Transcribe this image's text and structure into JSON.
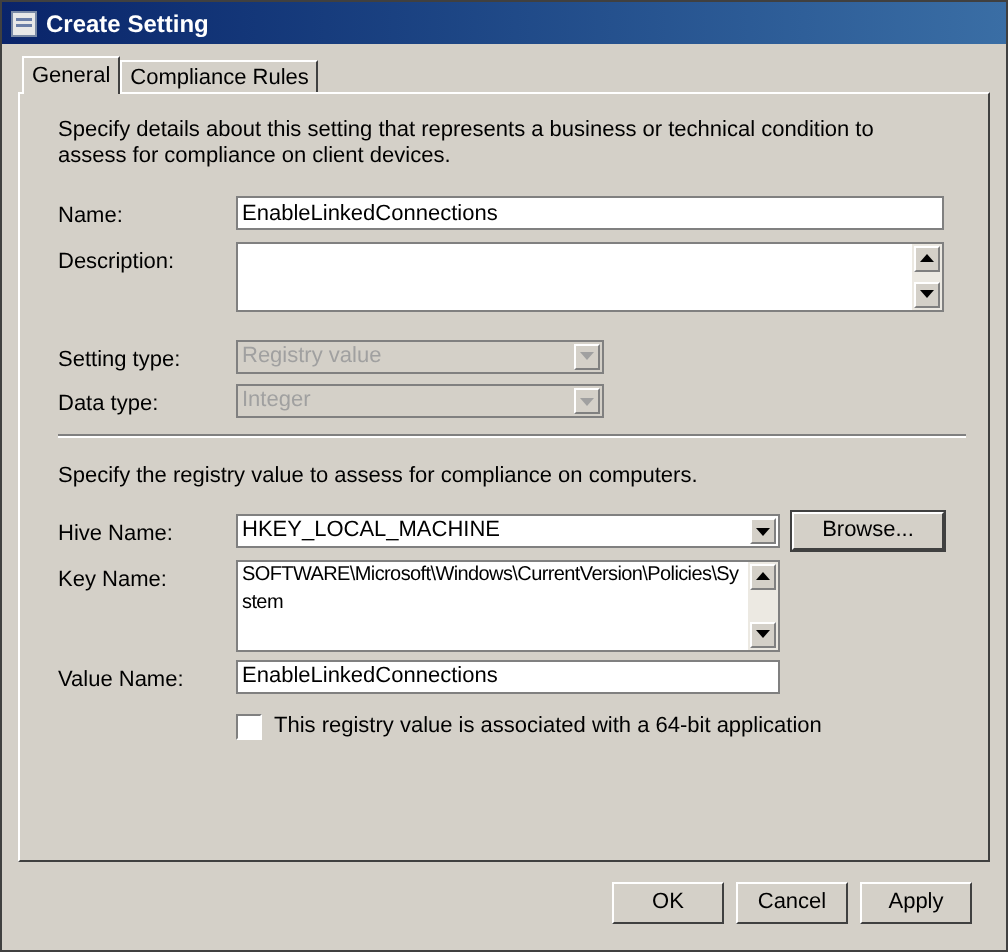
{
  "window": {
    "title": "Create Setting"
  },
  "tabs": [
    {
      "label": "General",
      "selected": true
    },
    {
      "label": "Compliance Rules",
      "selected": false
    }
  ],
  "intro": "Specify details about this setting that represents a business or technical condition to assess for compliance on client devices.",
  "fields": [
    {
      "kind": "text",
      "label": "Name:",
      "value": "EnableLinkedConnections"
    },
    {
      "kind": "textarea",
      "label": "Description:"
    },
    {
      "kind": "select",
      "label": "Setting type:",
      "value": "Registry value",
      "disabled": true
    },
    {
      "kind": "select",
      "label": "Data type:",
      "value": "Integer",
      "disabled": true
    }
  ],
  "registry_intro": "Specify the registry value to assess for compliance on computers.",
  "registry_fields": [
    {
      "kind": "select",
      "label": "Hive Name:",
      "value": "HKEY_LOCAL_MACHINE",
      "disabled": false,
      "button": "Browse..."
    },
    {
      "kind": "textarea",
      "label": "Key Name:",
      "value": "SOFTWARE\\Microsoft\\Windows\\CurrentVersion\\Policies\\System"
    },
    {
      "kind": "text",
      "label": "Value Name:",
      "value": "EnableLinkedConnections"
    }
  ],
  "checkbox": {
    "label": "This registry value is associated with a 64-bit application",
    "checked": false
  },
  "buttons": [
    "OK",
    "Cancel",
    "Apply"
  ]
}
